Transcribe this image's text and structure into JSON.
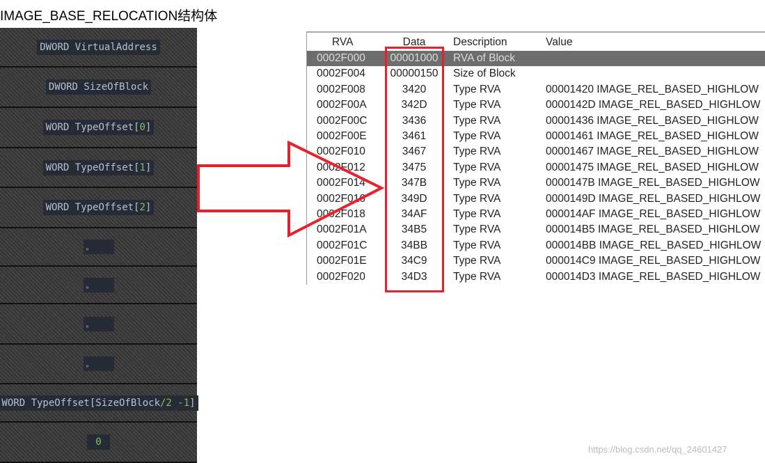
{
  "title": "IMAGE_BASE_RELOCATION结构体",
  "struct_fields": [
    {
      "text": "DWORD VirtualAddress"
    },
    {
      "text": "DWORD SizeOfBlock"
    },
    {
      "pre": "WORD TypeOffset[",
      "num": "0",
      "post": "]"
    },
    {
      "pre": "WORD TypeOffset[",
      "num": "1",
      "post": "]"
    },
    {
      "pre": "WORD TypeOffset[",
      "num": "2",
      "post": "]"
    },
    {
      "text": "。"
    },
    {
      "text": "。"
    },
    {
      "text": "。"
    },
    {
      "text": "。"
    },
    {
      "pre": "WORD TypeOffset[SizeOfBlock",
      "num": "/2 -1",
      "post": "]"
    },
    {
      "num": "0"
    }
  ],
  "table": {
    "columns": [
      "RVA",
      "Data",
      "Description",
      "Value"
    ],
    "rows": [
      [
        "0002F000",
        "00001000",
        "RVA of Block",
        ""
      ],
      [
        "0002F004",
        "00000150",
        "Size of Block",
        ""
      ],
      [
        "0002F008",
        "3420",
        "Type RVA",
        "00001420 IMAGE_REL_BASED_HIGHLOW"
      ],
      [
        "0002F00A",
        "342D",
        "Type RVA",
        "0000142D IMAGE_REL_BASED_HIGHLOW"
      ],
      [
        "0002F00C",
        "3436",
        "Type RVA",
        "00001436 IMAGE_REL_BASED_HIGHLOW"
      ],
      [
        "0002F00E",
        "3461",
        "Type RVA",
        "00001461 IMAGE_REL_BASED_HIGHLOW"
      ],
      [
        "0002F010",
        "3467",
        "Type RVA",
        "00001467 IMAGE_REL_BASED_HIGHLOW"
      ],
      [
        "0002F012",
        "3475",
        "Type RVA",
        "00001475 IMAGE_REL_BASED_HIGHLOW"
      ],
      [
        "0002F014",
        "347B",
        "Type RVA",
        "0000147B IMAGE_REL_BASED_HIGHLOW"
      ],
      [
        "0002F016",
        "349D",
        "Type RVA",
        "0000149D IMAGE_REL_BASED_HIGHLOW"
      ],
      [
        "0002F018",
        "34AF",
        "Type RVA",
        "000014AF IMAGE_REL_BASED_HIGHLOW"
      ],
      [
        "0002F01A",
        "34B5",
        "Type RVA",
        "000014B5 IMAGE_REL_BASED_HIGHLOW"
      ],
      [
        "0002F01C",
        "34BB",
        "Type RVA",
        "000014BB IMAGE_REL_BASED_HIGHLOW"
      ],
      [
        "0002F01E",
        "34C9",
        "Type RVA",
        "000014C9 IMAGE_REL_BASED_HIGHLOW"
      ],
      [
        "0002F020",
        "34D3",
        "Type RVA",
        "000014D3 IMAGE_REL_BASED_HIGHLOW"
      ]
    ],
    "selected_row": 0
  },
  "colors": {
    "highlight": "#e8202a",
    "panel": "#3b3b3b",
    "label_bg": "#262b36",
    "number": "#7fbf5f"
  },
  "watermark": "https://blog.csdn.net/qq_24601427"
}
